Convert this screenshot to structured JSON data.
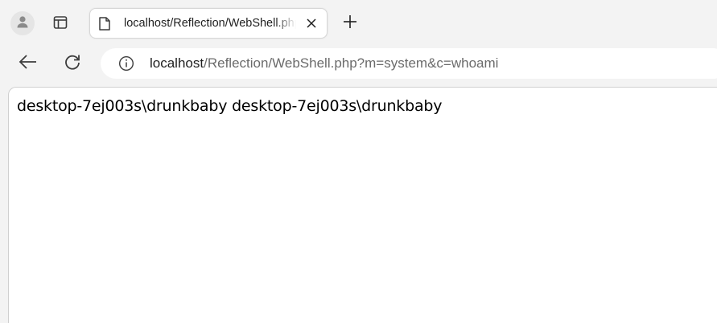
{
  "browser": {
    "profile_icon": "person-icon",
    "tab_actions_icon": "tab-actions-icon",
    "tab": {
      "title": "localhost/Reflection/WebShell.php?m=system&c=whoami",
      "favicon": "document-icon",
      "close_icon": "close-icon"
    },
    "new_tab_icon": "plus-icon",
    "toolbar": {
      "back_icon": "back-arrow-icon",
      "reload_icon": "reload-icon",
      "site_info_icon": "info-icon",
      "url_host": "localhost",
      "url_path": "/Reflection/WebShell.php?m=system&c=whoami"
    }
  },
  "page": {
    "output_text": "desktop-7ej003s\\drunkbaby desktop-7ej003s\\drunkbaby"
  },
  "colors": {
    "chrome_bg": "#f3f3f3",
    "tab_bg": "#ffffff",
    "url_host": "#1f1f1f",
    "url_path": "#6b6b6b",
    "icon": "#3c3c3c"
  }
}
